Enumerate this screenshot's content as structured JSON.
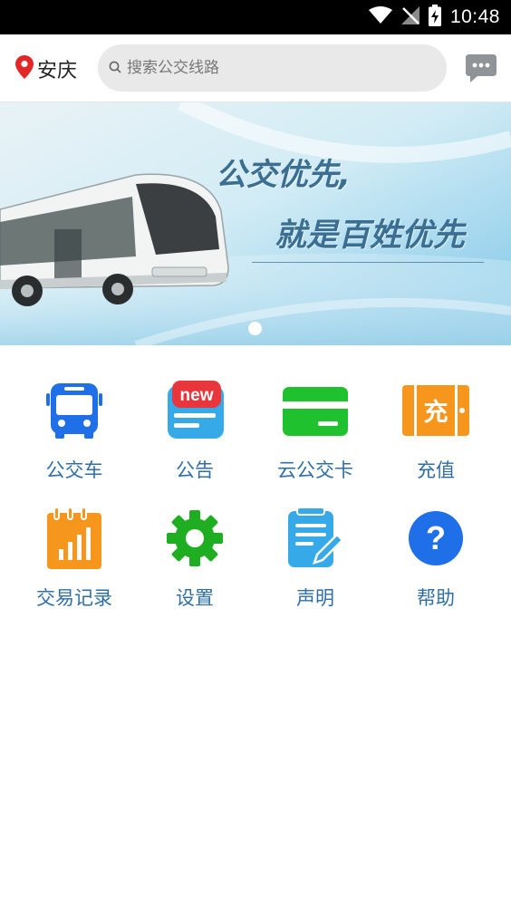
{
  "status_bar": {
    "time": "10:48"
  },
  "header": {
    "city": "安庆",
    "search_placeholder": "搜索公交线路"
  },
  "banner": {
    "slogan_line1": "公交优先,",
    "slogan_line2": "就是百姓优先"
  },
  "menu": [
    {
      "label": "公交车",
      "icon": "bus-icon"
    },
    {
      "label": "公告",
      "icon": "announcement-icon",
      "badge": "new"
    },
    {
      "label": "云公交卡",
      "icon": "card-icon"
    },
    {
      "label": "充值",
      "icon": "recharge-icon",
      "icon_text": "充"
    },
    {
      "label": "交易记录",
      "icon": "transaction-record-icon"
    },
    {
      "label": "设置",
      "icon": "gear-icon"
    },
    {
      "label": "声明",
      "icon": "statement-icon"
    },
    {
      "label": "帮助",
      "icon": "help-icon",
      "icon_text": "?"
    }
  ],
  "colors": {
    "bus_blue": "#1e6fe8",
    "announce_blue": "#36a9e9",
    "badge_red": "#e8363c",
    "card_green": "#1fc12e",
    "orange": "#f7961d",
    "gear_green": "#1fae22",
    "label_blue": "#2f6fa6"
  }
}
